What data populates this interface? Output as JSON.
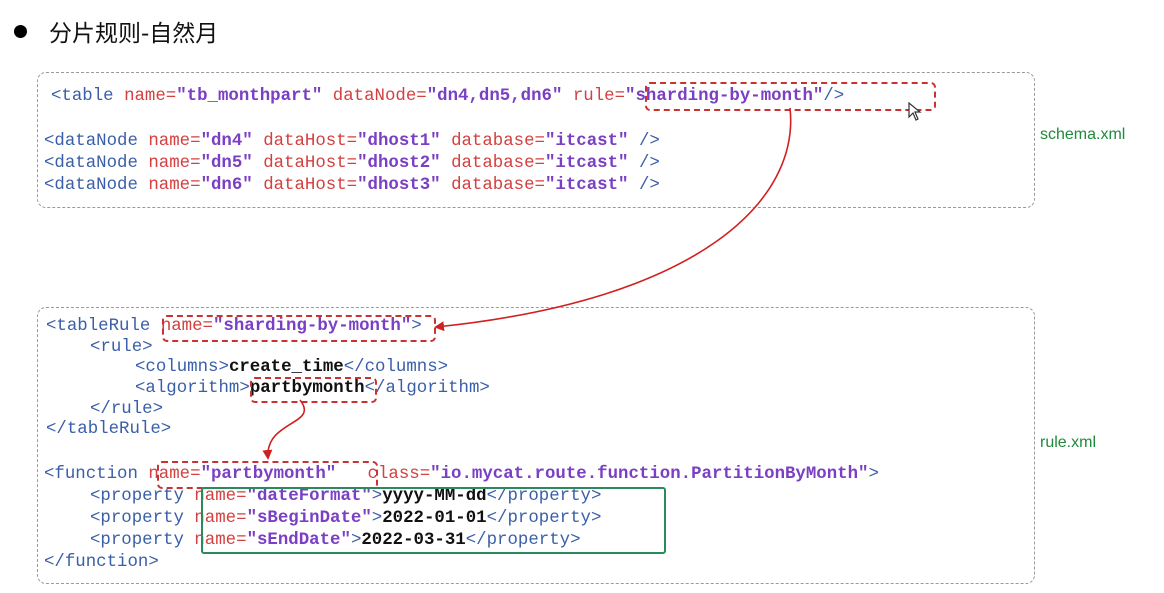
{
  "heading": {
    "text": "分片规则-自然月"
  },
  "schema": {
    "filename": "schema.xml",
    "table_line": {
      "open": "<table",
      "name_attr": "name=",
      "name_val": "\"tb_monthpart\"",
      "node_attr": "dataNode=",
      "node_val": "\"dn4,dn5,dn6\"",
      "rule_attr": "rule=",
      "rule_val": "\"sharding-by-month\"",
      "close": "/>"
    },
    "datanodes": [
      {
        "open": "<dataNode",
        "name_attr": "name=",
        "name_val": "\"dn4\"",
        "host_attr": "dataHost=",
        "host_val": "\"dhost1\"",
        "db_attr": "database=",
        "db_val": "\"itcast\"",
        "close": "/>"
      },
      {
        "open": "<dataNode",
        "name_attr": "name=",
        "name_val": "\"dn5\"",
        "host_attr": "dataHost=",
        "host_val": "\"dhost2\"",
        "db_attr": "database=",
        "db_val": "\"itcast\"",
        "close": "/>"
      },
      {
        "open": "<dataNode",
        "name_attr": "name=",
        "name_val": "\"dn6\"",
        "host_attr": "dataHost=",
        "host_val": "\"dhost3\"",
        "db_attr": "database=",
        "db_val": "\"itcast\"",
        "close": "/>"
      }
    ]
  },
  "rule": {
    "filename": "rule.xml",
    "tablerule_open": "<tableRule",
    "tablerule_name_attr": "name=",
    "tablerule_name_val": "\"sharding-by-month\"",
    "tablerule_gt": ">",
    "rule_open": "<rule>",
    "columns_open": "<columns>",
    "columns_val": "create_time",
    "columns_close": "</columns>",
    "algorithm_open": "<algorithm>",
    "algorithm_val": "partbymonth",
    "algorithm_close": "</algorithm>",
    "rule_close": "</rule>",
    "tablerule_close": "</tableRule>",
    "function_open": "<function",
    "function_name_attr": "name=",
    "function_name_val": "\"partbymonth\"",
    "function_class_attr": "class=",
    "function_class_val": "\"io.mycat.route.function.PartitionByMonth\"",
    "function_gt": ">",
    "properties": [
      {
        "open": "<property",
        "name_attr": "name=",
        "name_val": "\"dateFormat\"",
        "gt": ">",
        "value": "yyyy-MM-dd",
        "close": "</property>"
      },
      {
        "open": "<property",
        "name_attr": "name=",
        "name_val": "\"sBeginDate\"",
        "gt": ">",
        "value": "2022-01-01",
        "close": "</property>"
      },
      {
        "open": "<property",
        "name_attr": "name=",
        "name_val": "\"sEndDate\"",
        "gt": ">",
        "value": "2022-03-31",
        "close": "</property>"
      }
    ],
    "function_close": "</function>"
  }
}
